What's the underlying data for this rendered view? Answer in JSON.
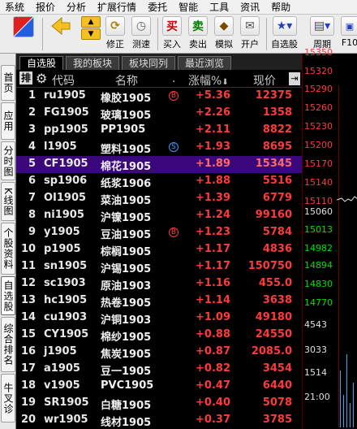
{
  "menu": [
    "系统",
    "报价",
    "分析",
    "扩展行情",
    "委托",
    "智能",
    "工具",
    "资讯",
    "帮助"
  ],
  "toolbar": {
    "buttons": [
      {
        "label": "",
        "icon": "app-logo-icon"
      },
      {
        "label": "",
        "icon": "back-arrow-icon"
      },
      {
        "label": "修正",
        "icon": "revise-icon"
      },
      {
        "label": "测速",
        "icon": "speed-test-icon"
      },
      {
        "label": "买入",
        "icon": "buy-icon",
        "glyph": "买",
        "color": "#c00000"
      },
      {
        "label": "卖出",
        "icon": "sell-icon",
        "glyph": "卖",
        "color": "#008000"
      },
      {
        "label": "模拟",
        "icon": "simulate-icon"
      },
      {
        "label": "开户",
        "icon": "open-account-icon"
      },
      {
        "label": "自选股",
        "icon": "watchlist-icon"
      },
      {
        "label": "周期",
        "icon": "period-icon"
      },
      {
        "label": "F10",
        "icon": "f10-icon"
      }
    ]
  },
  "left_tabs": [
    {
      "label": "首页",
      "active": false
    },
    {
      "label": "应用",
      "active": false
    },
    {
      "label": "分时图",
      "active": false
    },
    {
      "label": "K线图",
      "active": false
    },
    {
      "label": "个股资料",
      "active": false
    },
    {
      "label": "自选股",
      "active": true
    },
    {
      "label": "综合排名",
      "active": false
    },
    {
      "label": "牛叉诊",
      "active": false
    }
  ],
  "watch_tabs": [
    "自选股",
    "我的板块",
    "板块同列",
    "最近浏览"
  ],
  "active_watch_tab": 0,
  "table": {
    "headers": {
      "idx": "排",
      "code": "代码",
      "name": "名称",
      "dot": ".",
      "change": "涨幅%",
      "price": "现价"
    },
    "rows": [
      {
        "idx": "1",
        "code": "ru1905",
        "name": "橡胶1905",
        "mark": "B",
        "change": "+5.36",
        "price": "12375"
      },
      {
        "idx": "2",
        "code": "FG1905",
        "name": "玻璃1905",
        "mark": "",
        "change": "+2.26",
        "price": "1358"
      },
      {
        "idx": "3",
        "code": "pp1905",
        "name": "PP1905",
        "mark": "",
        "change": "+2.11",
        "price": "8822"
      },
      {
        "idx": "4",
        "code": "l1905",
        "name": "塑料1905",
        "mark": "S",
        "change": "+1.93",
        "price": "8695"
      },
      {
        "idx": "5",
        "code": "CF1905",
        "name": "棉花1905",
        "mark": "",
        "change": "+1.89",
        "price": "15345"
      },
      {
        "idx": "6",
        "code": "sp1906",
        "name": "纸浆1906",
        "mark": "",
        "change": "+1.88",
        "price": "5516"
      },
      {
        "idx": "7",
        "code": "OI1905",
        "name": "菜油1905",
        "mark": "",
        "change": "+1.39",
        "price": "6779"
      },
      {
        "idx": "8",
        "code": "ni1905",
        "name": "沪镍1905",
        "mark": "",
        "change": "+1.24",
        "price": "99160"
      },
      {
        "idx": "9",
        "code": "y1905",
        "name": "豆油1905",
        "mark": "B",
        "change": "+1.23",
        "price": "5784"
      },
      {
        "idx": "10",
        "code": "p1905",
        "name": "棕榈1905",
        "mark": "",
        "change": "+1.17",
        "price": "4836"
      },
      {
        "idx": "11",
        "code": "sn1905",
        "name": "沪锡1905",
        "mark": "",
        "change": "+1.17",
        "price": "150750"
      },
      {
        "idx": "12",
        "code": "sc1903",
        "name": "原油1903",
        "mark": "",
        "change": "+1.16",
        "price": "455.0"
      },
      {
        "idx": "13",
        "code": "hc1905",
        "name": "热卷1905",
        "mark": "",
        "change": "+1.14",
        "price": "3638"
      },
      {
        "idx": "14",
        "code": "cu1903",
        "name": "沪铜1903",
        "mark": "",
        "change": "+1.09",
        "price": "49180"
      },
      {
        "idx": "15",
        "code": "CY1905",
        "name": "棉纱1905",
        "mark": "",
        "change": "+0.88",
        "price": "24550"
      },
      {
        "idx": "16",
        "code": "j1905",
        "name": "焦炭1905",
        "mark": "",
        "change": "+0.87",
        "price": "2085.0"
      },
      {
        "idx": "17",
        "code": "a1905",
        "name": "豆一1905",
        "mark": "",
        "change": "+0.82",
        "price": "3454"
      },
      {
        "idx": "18",
        "code": "v1905",
        "name": "PVC1905",
        "mark": "",
        "change": "+0.47",
        "price": "6440"
      },
      {
        "idx": "19",
        "code": "SR1905",
        "name": "白糖1905",
        "mark": "",
        "change": "+0.40",
        "price": "5078"
      },
      {
        "idx": "20",
        "code": "wr1905",
        "name": "线材1905",
        "mark": "",
        "change": "+0.37",
        "price": "3785"
      }
    ],
    "selected_row": 5
  },
  "chart_axis": {
    "labels": [
      {
        "text": "15350",
        "tone": "up"
      },
      {
        "text": "15320",
        "tone": "up"
      },
      {
        "text": "15290",
        "tone": "up"
      },
      {
        "text": "15260",
        "tone": "up"
      },
      {
        "text": "15230",
        "tone": "up"
      },
      {
        "text": "15200",
        "tone": "up"
      },
      {
        "text": "15170",
        "tone": "up"
      },
      {
        "text": "15140",
        "tone": "up"
      },
      {
        "text": "15110",
        "tone": "up"
      },
      {
        "text": "15060",
        "tone": "mid"
      },
      {
        "text": "15013",
        "tone": "dn"
      },
      {
        "text": "14982",
        "tone": "dn"
      },
      {
        "text": "14894",
        "tone": "dn"
      },
      {
        "text": "14830",
        "tone": "dn"
      },
      {
        "text": "14770",
        "tone": "dn"
      },
      {
        "text": "4543",
        "tone": "mid"
      },
      {
        "text": "3033",
        "tone": "mid"
      },
      {
        "text": "1514",
        "tone": "mid"
      },
      {
        "text": "21:00",
        "tone": "time"
      }
    ]
  },
  "colors": {
    "up": "#ff3a3a",
    "down": "#00e000",
    "selected_row_bg": "#3a087a",
    "mark_B": "#ff3a3a",
    "mark_S": "#3a9aff"
  }
}
